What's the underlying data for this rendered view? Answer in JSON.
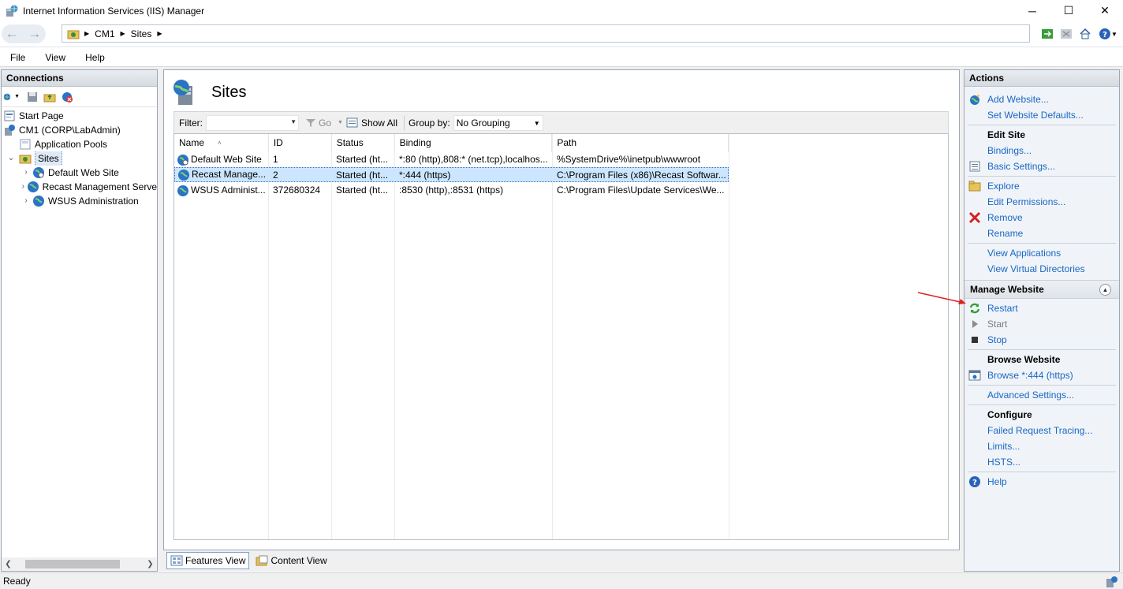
{
  "window": {
    "title": "Internet Information Services (IIS) Manager",
    "minimize": "─",
    "maximize": "☐",
    "close": "✕"
  },
  "address": {
    "crumbs": [
      "CM1",
      "Sites"
    ]
  },
  "menu": [
    "File",
    "View",
    "Help"
  ],
  "connections": {
    "title": "Connections",
    "tree": [
      {
        "label": "Start Page",
        "level": 0,
        "icon": "start-page-icon"
      },
      {
        "label": "CM1 (CORP\\LabAdmin)",
        "level": 0,
        "icon": "server-icon"
      },
      {
        "label": "Application Pools",
        "level": 1,
        "icon": "app-pools-icon"
      },
      {
        "label": "Sites",
        "level": 1,
        "icon": "sites-folder-icon",
        "selected": true,
        "expanded": true
      },
      {
        "label": "Default Web Site",
        "level": 2,
        "icon": "globe-icon"
      },
      {
        "label": "Recast Management Serve",
        "level": 2,
        "icon": "globe-icon"
      },
      {
        "label": "WSUS Administration",
        "level": 2,
        "icon": "globe-icon"
      }
    ]
  },
  "center": {
    "title": "Sites",
    "filter_label": "Filter:",
    "filter_value": "",
    "go_label": "Go",
    "show_all_label": "Show All",
    "group_by_label": "Group by:",
    "group_by_value": "No Grouping",
    "columns": [
      "Name",
      "ID",
      "Status",
      "Binding",
      "Path"
    ],
    "rows": [
      {
        "name": "Default Web Site",
        "id": "1",
        "status": "Started (ht...",
        "binding": "*:80 (http),808:* (net.tcp),localhos...",
        "path": "%SystemDrive%\\inetpub\\wwwroot",
        "selected": false
      },
      {
        "name": "Recast Manage...",
        "id": "2",
        "status": "Started (ht...",
        "binding": "*:444 (https)",
        "path": "C:\\Program Files (x86)\\Recast Softwar...",
        "selected": true
      },
      {
        "name": "WSUS Administ...",
        "id": "372680324",
        "status": "Started (ht...",
        "binding": ":8530 (http),:8531 (https)",
        "path": "C:\\Program Files\\Update Services\\We...",
        "selected": false
      }
    ],
    "tabs": [
      "Features View",
      "Content View"
    ]
  },
  "actions": {
    "title": "Actions",
    "top": [
      {
        "label": "Add Website...",
        "icon": "add-website-icon"
      },
      {
        "label": "Set Website Defaults...",
        "icon": ""
      }
    ],
    "edit_site": {
      "header": "Edit Site",
      "items": [
        {
          "label": "Bindings...",
          "icon": ""
        },
        {
          "label": "Basic Settings...",
          "icon": "basic-settings-icon"
        }
      ]
    },
    "explore_group": [
      {
        "label": "Explore",
        "icon": "explore-icon"
      },
      {
        "label": "Edit Permissions...",
        "icon": ""
      },
      {
        "label": "Remove",
        "icon": "remove-icon"
      },
      {
        "label": "Rename",
        "icon": ""
      }
    ],
    "view_group": [
      {
        "label": "View Applications",
        "icon": ""
      },
      {
        "label": "View Virtual Directories",
        "icon": ""
      }
    ],
    "manage": {
      "header": "Manage Website",
      "items": [
        {
          "label": "Restart",
          "icon": "restart-icon",
          "disabled": false
        },
        {
          "label": "Start",
          "icon": "start-icon",
          "disabled": true
        },
        {
          "label": "Stop",
          "icon": "stop-icon",
          "disabled": false
        }
      ]
    },
    "browse": {
      "header": "Browse Website",
      "items": [
        {
          "label": "Browse *:444 (https)",
          "icon": "browse-icon"
        }
      ]
    },
    "advanced": [
      {
        "label": "Advanced Settings...",
        "icon": ""
      }
    ],
    "configure": {
      "header": "Configure",
      "items": [
        {
          "label": "Failed Request Tracing...",
          "icon": ""
        },
        {
          "label": "Limits...",
          "icon": ""
        },
        {
          "label": "HSTS...",
          "icon": ""
        }
      ]
    },
    "help": [
      {
        "label": "Help",
        "icon": "help-icon"
      }
    ]
  },
  "status": {
    "text": "Ready"
  },
  "colors": {
    "link": "#1a66c4",
    "selection": "#cce6ff",
    "annotation_arrow": "#e02020"
  }
}
